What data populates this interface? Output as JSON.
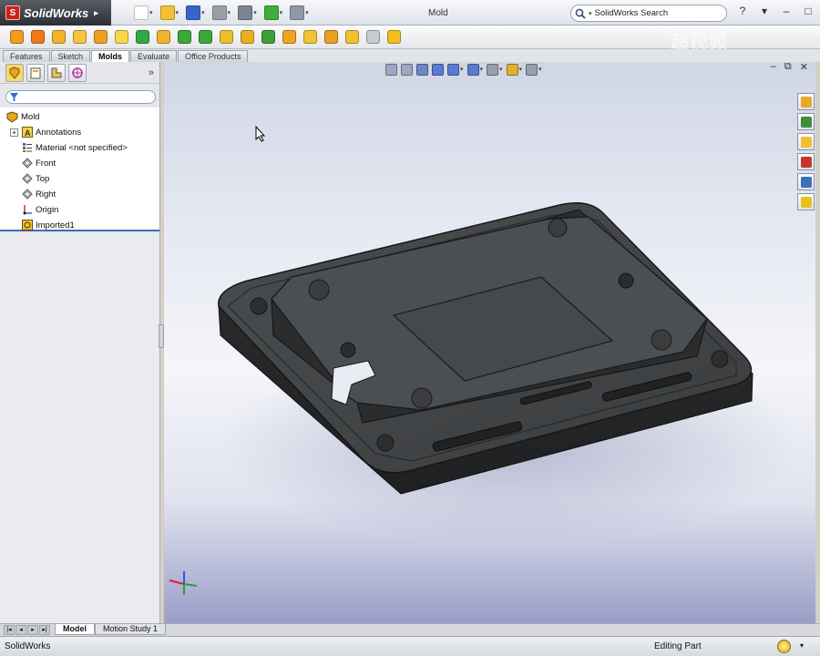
{
  "app": {
    "name": "SolidWorks",
    "document_title": "Mold",
    "search_placeholder": "SolidWorks Search",
    "window_controls": [
      "?",
      "▾",
      "–",
      "□",
      "✕"
    ]
  },
  "quick_access": [
    {
      "name": "new-document-icon",
      "color": "#ffffff"
    },
    {
      "name": "open-folder-icon",
      "color": "#f2c230"
    },
    {
      "name": "save-icon",
      "color": "#3a64c8"
    },
    {
      "name": "print-icon",
      "color": "#9aa0a8"
    },
    {
      "name": "undo-icon",
      "color": "#7b8592"
    },
    {
      "name": "rebuild-icon",
      "color": "#3fae3a"
    },
    {
      "name": "options-icon",
      "color": "#8f98a6"
    }
  ],
  "command_tools": [
    "#f29a1a",
    "#f07a1a",
    "#f2b32a",
    "#f5c53a",
    "#f0a020",
    "#f7d84a",
    "#2fa84a",
    "#f2b22a",
    "#3aa83a",
    "#3aa83a",
    "#e8c030",
    "#e8b020",
    "#3f9f3a",
    "#f2a420",
    "#f1c32f",
    "#e8a020",
    "#eec12e",
    "#c8cdd4",
    "#f0c020"
  ],
  "command_tabs": [
    {
      "label": "Features",
      "active": false
    },
    {
      "label": "Sketch",
      "active": false
    },
    {
      "label": "Molds",
      "active": true
    },
    {
      "label": "Evaluate",
      "active": false
    },
    {
      "label": "Office Products",
      "active": false
    }
  ],
  "watermark": "超视频",
  "panel_tabs": [
    "feature-manager-icon",
    "property-manager-icon",
    "configuration-manager-icon",
    "dim-xpert-icon"
  ],
  "panel_expand": "»",
  "tree": {
    "root": "Mold",
    "items": [
      {
        "label": "Annotations",
        "icon": "annotations-icon",
        "expandable": true
      },
      {
        "label": "Material <not specified>",
        "icon": "material-icon",
        "expandable": false
      },
      {
        "label": "Front",
        "icon": "plane-icon",
        "expandable": false
      },
      {
        "label": "Top",
        "icon": "plane-icon",
        "expandable": false
      },
      {
        "label": "Right",
        "icon": "plane-icon",
        "expandable": false
      },
      {
        "label": "Origin",
        "icon": "origin-icon",
        "expandable": false
      },
      {
        "label": "Imported1",
        "icon": "imported-body-icon",
        "expandable": false
      }
    ]
  },
  "bottom_tabs": [
    {
      "label": "Model",
      "active": true
    },
    {
      "label": "Motion Study 1",
      "active": false
    }
  ],
  "status": {
    "app": "SolidWorks",
    "mode": "Editing Part"
  },
  "heads_up_toolbar": [
    "zoom-to-fit-icon",
    "zoom-to-area-icon",
    "previous-view-icon",
    "section-view-icon",
    "view-orientation-icon",
    "display-style-icon",
    "hide-show-items-icon",
    "edit-appearance-icon",
    "apply-scene-icon"
  ],
  "task_pane": [
    {
      "name": "solidworks-resources-icon",
      "color": "#e7a92c"
    },
    {
      "name": "design-library-icon",
      "color": "#3f8f3a"
    },
    {
      "name": "file-explorer-icon",
      "color": "#f0c030"
    },
    {
      "name": "search-results-icon",
      "color": "#c8342a"
    },
    {
      "name": "view-palette-icon",
      "color": "#3d6fb6"
    },
    {
      "name": "appearances-icon",
      "color": "#e8c020"
    }
  ]
}
